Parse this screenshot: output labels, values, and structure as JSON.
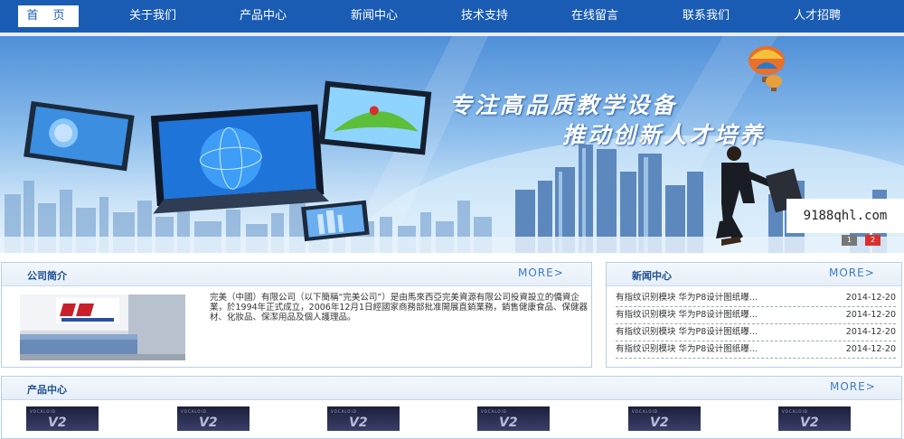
{
  "nav": {
    "items": [
      "首 页",
      "关于我们",
      "产品中心",
      "新闻中心",
      "技术支持",
      "在线留言",
      "联系我们",
      "人才招聘"
    ]
  },
  "banner": {
    "slogan_1": "专注高品质教学设备",
    "slogan_2": "推动创新人才培养",
    "watermark": "9188qhl.com",
    "slides": [
      "1",
      "2"
    ]
  },
  "about": {
    "title": "公司简介",
    "more": "MORE>",
    "text": "完美（中國）有限公司（以下簡稱“完美公司”）是由馬來西亞完美資源有限公司投資設立的僑資企業，於1994年正式成立，2006年12月1日經國家商務部批准開展直銷業務，銷售健康食品、保健器材、化妝品、保潔用品及個人護理品。"
  },
  "news": {
    "title": "新闻中心",
    "more": "MORE>",
    "items": [
      {
        "title": "有指纹识别模块 华为P8设计图纸曝...",
        "date": "2014-12-20"
      },
      {
        "title": "有指纹识别模块 华为P8设计图纸曝...",
        "date": "2014-12-20"
      },
      {
        "title": "有指纹识别模块 华为P8设计图纸曝...",
        "date": "2014-12-20"
      },
      {
        "title": "有指纹识别模块 华为P8设计图纸曝...",
        "date": "2014-12-20"
      }
    ]
  },
  "products": {
    "title": "产品中心",
    "more": "MORE>",
    "items": [
      {
        "brand": "VOCALOID",
        "logo": "V2"
      },
      {
        "brand": "VOCALOID",
        "logo": "V2"
      },
      {
        "brand": "VOCALOID",
        "logo": "V2"
      },
      {
        "brand": "VOCALOID",
        "logo": "V2"
      },
      {
        "brand": "VOCALOID",
        "logo": "V2"
      },
      {
        "brand": "VOCALOID",
        "logo": "V2"
      }
    ]
  },
  "colors": {
    "nav_bg": "#1a5cb4",
    "accent": "#3a7bc8",
    "slide_active": "#d83030"
  }
}
